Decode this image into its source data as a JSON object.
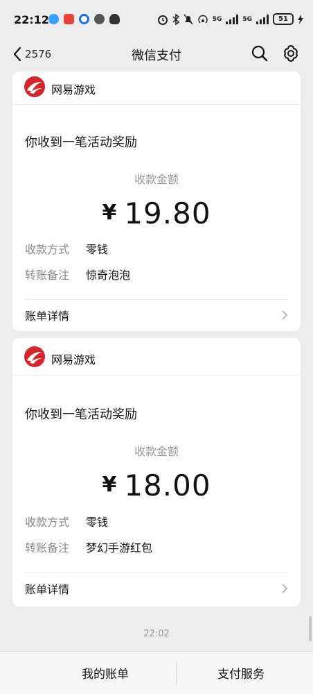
{
  "status_bar": {
    "time": "22:12",
    "network_1": "5G",
    "network_2": "5G",
    "battery": "51"
  },
  "nav": {
    "back_count": "2576",
    "title": "微信支付"
  },
  "messages": [
    {
      "app_name": "网易游戏",
      "subtitle": "你收到一笔活动奖励",
      "amount_label": "收款金额",
      "currency": "¥",
      "amount": "19.80",
      "method_key": "收款方式",
      "method_value": "零钱",
      "note_key": "转账备注",
      "note_value": "惊奇泡泡",
      "detail_label": "账单详情"
    },
    {
      "app_name": "网易游戏",
      "subtitle": "你收到一笔活动奖励",
      "amount_label": "收款金额",
      "currency": "¥",
      "amount": "18.00",
      "method_key": "收款方式",
      "method_value": "零钱",
      "note_key": "转账备注",
      "note_value": "梦幻手游红包",
      "detail_label": "账单详情"
    }
  ],
  "timestamp": "22:02",
  "bottom_bar": {
    "left_label": "我的账单",
    "right_label": "支付服务"
  },
  "colors": {
    "background": "#ededed",
    "card": "#ffffff",
    "brand_red": "#d7262b",
    "muted_text": "#888888"
  }
}
